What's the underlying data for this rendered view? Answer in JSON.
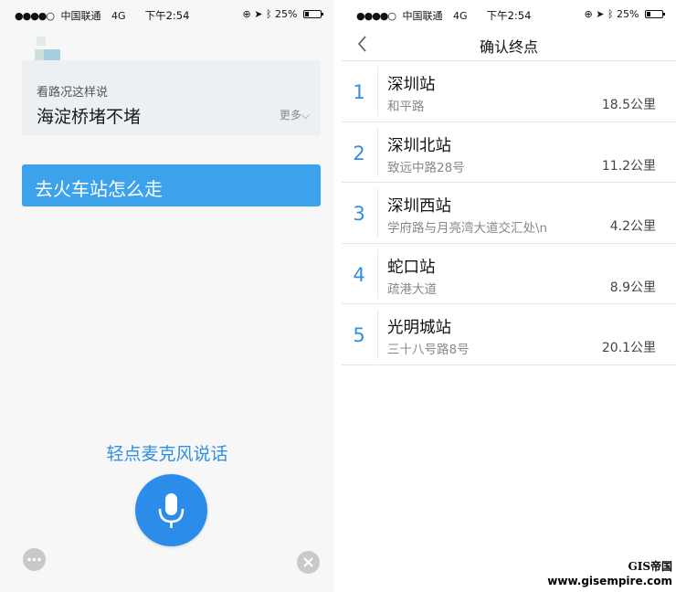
{
  "status_bar": {
    "carrier": "中国联通",
    "network": "4G",
    "time": "下午2:54",
    "battery": "25%"
  },
  "voice_screen": {
    "suggest_hint": "看路况这样说",
    "suggest_text": "海淀桥堵不堵",
    "more_label": "更多",
    "user_query": "去火车站怎么走",
    "tap_hint": "轻点麦克风说话"
  },
  "destination_screen": {
    "title": "确认终点",
    "stations": [
      {
        "index": "1",
        "name": "深圳站",
        "address": "和平路",
        "distance": "18.5公里"
      },
      {
        "index": "2",
        "name": "深圳北站",
        "address": "致远中路28号",
        "distance": "11.2公里"
      },
      {
        "index": "3",
        "name": "深圳西站",
        "address": "学府路与月亮湾大道交汇处\\n",
        "distance": "4.2公里"
      },
      {
        "index": "4",
        "name": "蛇口站",
        "address": "疏港大道",
        "distance": "8.9公里"
      },
      {
        "index": "5",
        "name": "光明城站",
        "address": "三十八号路8号",
        "distance": "20.1公里"
      }
    ]
  },
  "watermark": {
    "logo_text": "GIS帝国",
    "url": "www.gisempire.com"
  },
  "colors": {
    "accent": "#2b8de9",
    "bubble": "#3da2ec",
    "card": "#edf0f3"
  }
}
